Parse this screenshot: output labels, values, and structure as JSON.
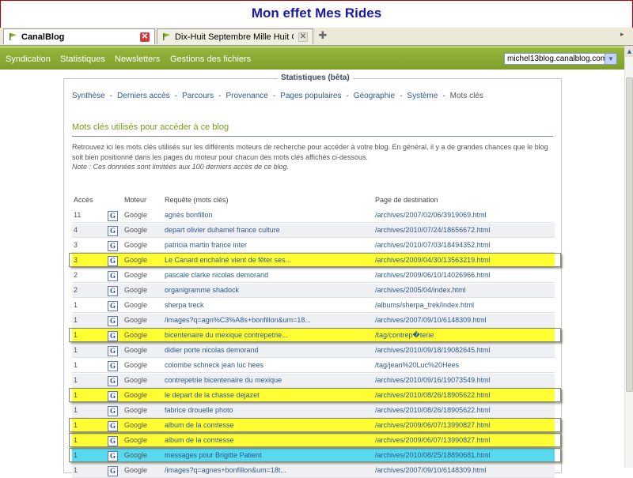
{
  "banner": {
    "title": "Mon effet Mes Rides"
  },
  "tabs": [
    {
      "label": "CanalBlog",
      "active": true
    },
    {
      "label": "Dix-Huit Septembre Mille Huit Cent Qua...",
      "active": false
    }
  ],
  "nav": {
    "items": [
      "Syndication",
      "Statistiques",
      "Newsletters",
      "Gestions des fichiers"
    ],
    "blog_select": "michel13blog.canalblog.com"
  },
  "panel": {
    "title": "Statistiques (bêta)",
    "subnav": [
      "Synthèse",
      "Derniers accès",
      "Parcours",
      "Provenance",
      "Pages populaires",
      "Géographie",
      "Système",
      "Mots clés"
    ],
    "section_title": "Mots clés utilisés pour accéder à ce blog",
    "intro": "Retrouvez ici les mots clés utilisés sur les différents moteurs de recherche pour accéder à votre blog. En général, il y a de grandes chances que le blog soit bien positionné dans les pages du moteur pour chacun des mots clés affichés ci-dessous.",
    "note": "Note : Ces données sont limitées aux 100 derniers accès de ce blog."
  },
  "table": {
    "headers": {
      "acces": "Accès",
      "moteur": "Moteur",
      "requete": "Requête (mots clés)",
      "page": "Page de destination"
    },
    "rows": [
      {
        "acces": "11",
        "moteur": "Google",
        "requete": "agnès bonfillon",
        "page": "/archives/2007/02/06/3919069.html",
        "hl": ""
      },
      {
        "acces": "4",
        "moteur": "Google",
        "requete": "depart olivier duhamel france culture",
        "page": "/archives/2010/07/24/18656672.html",
        "hl": ""
      },
      {
        "acces": "3",
        "moteur": "Google",
        "requete": "patricia martin france inter",
        "page": "/archives/2010/07/03/18494352.html",
        "hl": ""
      },
      {
        "acces": "3",
        "moteur": "Google",
        "requete": "Le Canard enchaîné vient de fêter ses...",
        "page": "/archives/2009/04/30/13563219.html",
        "hl": "yellow"
      },
      {
        "acces": "2",
        "moteur": "Google",
        "requete": "pascale clarke nicolas demorand",
        "page": "/archives/2009/06/10/14026966.html",
        "hl": ""
      },
      {
        "acces": "2",
        "moteur": "Google",
        "requete": "organigramme shadock",
        "page": "/archives/2005/04/index.html",
        "hl": ""
      },
      {
        "acces": "1",
        "moteur": "Google",
        "requete": "sherpa treck",
        "page": "/albums/sherpa_trek/index.html",
        "hl": ""
      },
      {
        "acces": "1",
        "moteur": "Google",
        "requete": "/images?q=agn%C3%A8s+bonfillon&um=18...",
        "page": "/archives/2007/09/10/6148309.html",
        "hl": ""
      },
      {
        "acces": "1",
        "moteur": "Google",
        "requete": "bicentenaire du mexique contrepetrie...",
        "page": "/tag/contrep�terie",
        "hl": "yellow"
      },
      {
        "acces": "1",
        "moteur": "Google",
        "requete": "didier porte nicolas demorand",
        "page": "/archives/2010/09/18/19082645.html",
        "hl": ""
      },
      {
        "acces": "1",
        "moteur": "Google",
        "requete": "colombe schneck jean luc hees",
        "page": "/tag/jean%20Luc%20Hees",
        "hl": ""
      },
      {
        "acces": "1",
        "moteur": "Google",
        "requete": "contrepetrie bicentenaire du mexique",
        "page": "/archives/2010/09/16/19073549.html",
        "hl": ""
      },
      {
        "acces": "1",
        "moteur": "Google",
        "requete": "le depart de la chasse dejazet",
        "page": "/archives/2010/08/26/18905622.html",
        "hl": "yellow"
      },
      {
        "acces": "1",
        "moteur": "Google",
        "requete": "fabrice drouelle photo",
        "page": "/archives/2010/08/26/18905622.html",
        "hl": ""
      },
      {
        "acces": "1",
        "moteur": "Google",
        "requete": "album de la comtesse",
        "page": "/archives/2009/06/07/13990827.html",
        "hl": "yellow"
      },
      {
        "acces": "1",
        "moteur": "Google",
        "requete": "album de la comtesse",
        "page": "/archives/2009/06/07/13990827.html",
        "hl": "yellow"
      },
      {
        "acces": "1",
        "moteur": "Google",
        "requete": "messages pour Brigitte Patient",
        "page": "/archives/2010/08/25/18890681.html",
        "hl": "cyan"
      },
      {
        "acces": "1",
        "moteur": "Google",
        "requete": "/images?q=agnes+bonfillon&um=18t...",
        "page": "/archives/2007/09/10/6148309.html",
        "hl": ""
      }
    ]
  },
  "colors": {
    "nav_green": "#8aad34",
    "highlight_yellow": "#ffff33",
    "highlight_cyan": "#58d9ee",
    "link_blue": "#2d5a8f",
    "section_green": "#7a9c1f"
  },
  "icons": {
    "favicon": "canalblog-flag-icon",
    "engine": "google-icon"
  }
}
